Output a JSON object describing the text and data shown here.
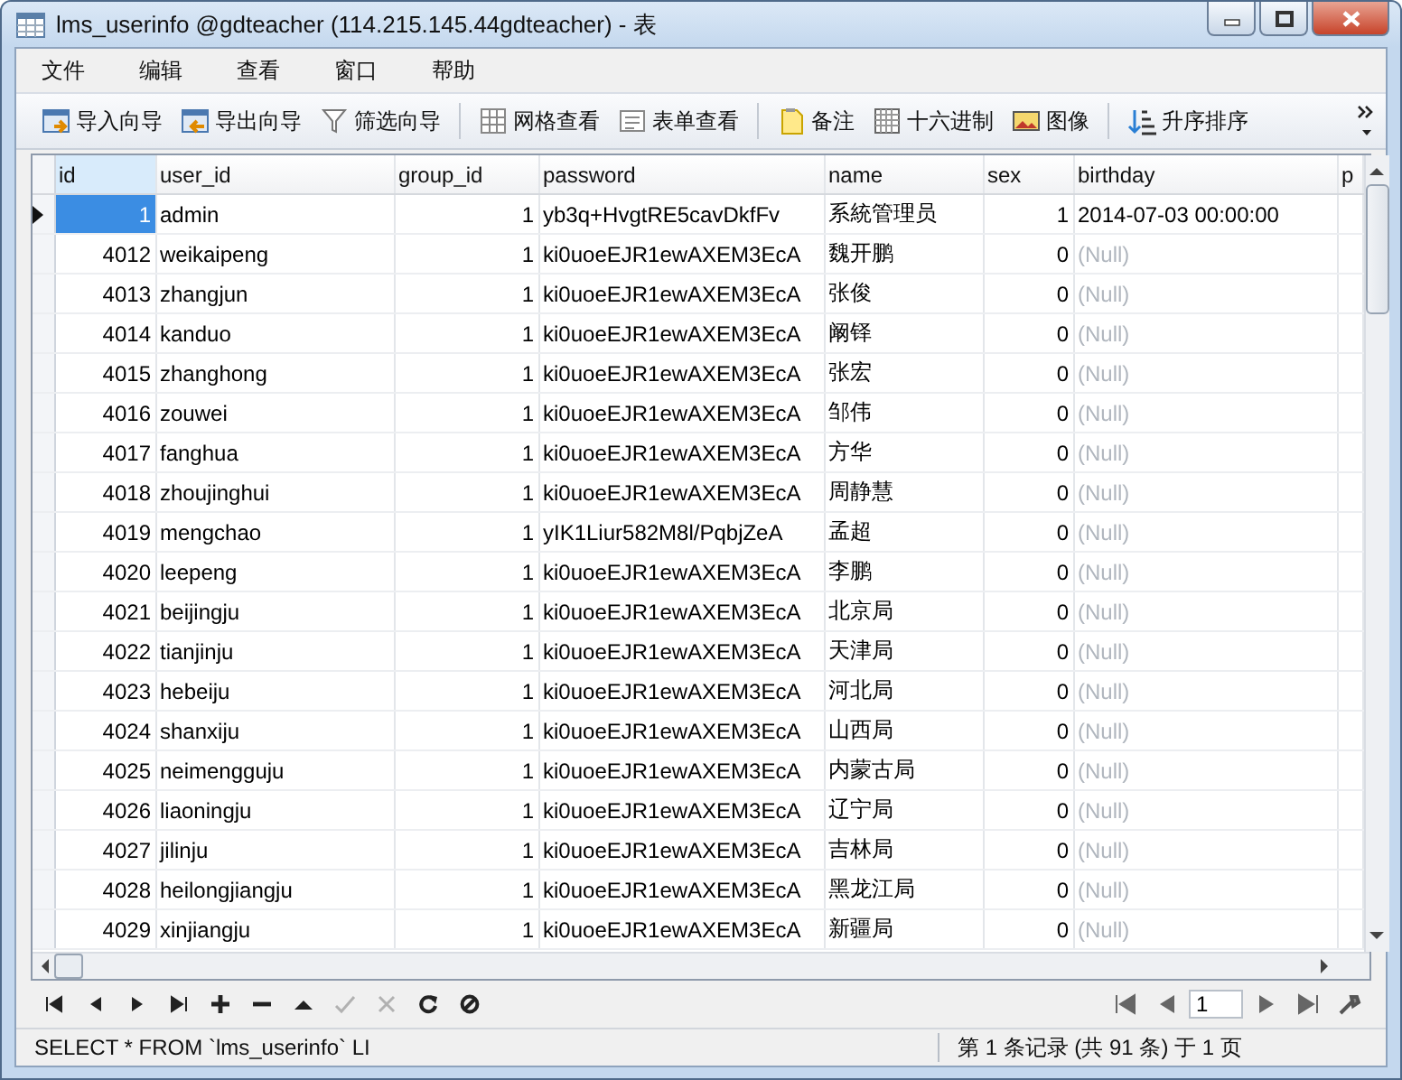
{
  "window": {
    "title": "lms_userinfo @gdteacher (114.215.145.44gdteacher) - 表"
  },
  "menu": [
    "文件",
    "编辑",
    "查看",
    "窗口",
    "帮助"
  ],
  "toolbar": [
    {
      "label": "导入向导",
      "kind": "import"
    },
    {
      "label": "导出向导",
      "kind": "export"
    },
    {
      "label": "筛选向导",
      "kind": "filter"
    },
    {
      "kind": "separator"
    },
    {
      "label": "网格查看",
      "kind": "grid"
    },
    {
      "label": "表单查看",
      "kind": "form"
    },
    {
      "kind": "separator"
    },
    {
      "label": "备注",
      "kind": "memo"
    },
    {
      "label": "十六进制",
      "kind": "hex"
    },
    {
      "label": "图像",
      "kind": "image"
    },
    {
      "kind": "separator"
    },
    {
      "label": "升序排序",
      "kind": "sort"
    }
  ],
  "table": {
    "columns": [
      "id",
      "user_id",
      "group_id",
      "password",
      "name",
      "sex",
      "birthday",
      "p"
    ],
    "rows": [
      {
        "id": "1",
        "user_id": "admin",
        "group_id": "1",
        "password": "yb3q+HvgtRE5cavDkfFv",
        "name": "系統管理员",
        "sex": "1",
        "birthday": "2014-07-03 00:00:00",
        "birthday_null": false,
        "selected": true
      },
      {
        "id": "4012",
        "user_id": "weikaipeng",
        "group_id": "1",
        "password": "ki0uoeEJR1ewAXEM3EcA",
        "name": "魏开鹏",
        "sex": "0",
        "birthday": "(Null)",
        "birthday_null": true,
        "selected": false
      },
      {
        "id": "4013",
        "user_id": "zhangjun",
        "group_id": "1",
        "password": "ki0uoeEJR1ewAXEM3EcA",
        "name": "张俊",
        "sex": "0",
        "birthday": "(Null)",
        "birthday_null": true,
        "selected": false
      },
      {
        "id": "4014",
        "user_id": "kanduo",
        "group_id": "1",
        "password": "ki0uoeEJR1ewAXEM3EcA",
        "name": "阚铎",
        "sex": "0",
        "birthday": "(Null)",
        "birthday_null": true,
        "selected": false
      },
      {
        "id": "4015",
        "user_id": "zhanghong",
        "group_id": "1",
        "password": "ki0uoeEJR1ewAXEM3EcA",
        "name": "张宏",
        "sex": "0",
        "birthday": "(Null)",
        "birthday_null": true,
        "selected": false
      },
      {
        "id": "4016",
        "user_id": "zouwei",
        "group_id": "1",
        "password": "ki0uoeEJR1ewAXEM3EcA",
        "name": "邹伟",
        "sex": "0",
        "birthday": "(Null)",
        "birthday_null": true,
        "selected": false
      },
      {
        "id": "4017",
        "user_id": "fanghua",
        "group_id": "1",
        "password": "ki0uoeEJR1ewAXEM3EcA",
        "name": "方华",
        "sex": "0",
        "birthday": "(Null)",
        "birthday_null": true,
        "selected": false
      },
      {
        "id": "4018",
        "user_id": "zhoujinghui",
        "group_id": "1",
        "password": "ki0uoeEJR1ewAXEM3EcA",
        "name": "周静慧",
        "sex": "0",
        "birthday": "(Null)",
        "birthday_null": true,
        "selected": false
      },
      {
        "id": "4019",
        "user_id": "mengchao",
        "group_id": "1",
        "password": "yIK1Liur582M8l/PqbjZeA",
        "name": "孟超",
        "sex": "0",
        "birthday": "(Null)",
        "birthday_null": true,
        "selected": false
      },
      {
        "id": "4020",
        "user_id": "leepeng",
        "group_id": "1",
        "password": "ki0uoeEJR1ewAXEM3EcA",
        "name": "李鹏",
        "sex": "0",
        "birthday": "(Null)",
        "birthday_null": true,
        "selected": false
      },
      {
        "id": "4021",
        "user_id": "beijingju",
        "group_id": "1",
        "password": "ki0uoeEJR1ewAXEM3EcA",
        "name": "北京局",
        "sex": "0",
        "birthday": "(Null)",
        "birthday_null": true,
        "selected": false
      },
      {
        "id": "4022",
        "user_id": "tianjinju",
        "group_id": "1",
        "password": "ki0uoeEJR1ewAXEM3EcA",
        "name": "天津局",
        "sex": "0",
        "birthday": "(Null)",
        "birthday_null": true,
        "selected": false
      },
      {
        "id": "4023",
        "user_id": "hebeiju",
        "group_id": "1",
        "password": "ki0uoeEJR1ewAXEM3EcA",
        "name": "河北局",
        "sex": "0",
        "birthday": "(Null)",
        "birthday_null": true,
        "selected": false
      },
      {
        "id": "4024",
        "user_id": "shanxiju",
        "group_id": "1",
        "password": "ki0uoeEJR1ewAXEM3EcA",
        "name": "山西局",
        "sex": "0",
        "birthday": "(Null)",
        "birthday_null": true,
        "selected": false
      },
      {
        "id": "4025",
        "user_id": "neimengguju",
        "group_id": "1",
        "password": "ki0uoeEJR1ewAXEM3EcA",
        "name": "内蒙古局",
        "sex": "0",
        "birthday": "(Null)",
        "birthday_null": true,
        "selected": false
      },
      {
        "id": "4026",
        "user_id": "liaoningju",
        "group_id": "1",
        "password": "ki0uoeEJR1ewAXEM3EcA",
        "name": "辽宁局",
        "sex": "0",
        "birthday": "(Null)",
        "birthday_null": true,
        "selected": false
      },
      {
        "id": "4027",
        "user_id": "jilinju",
        "group_id": "1",
        "password": "ki0uoeEJR1ewAXEM3EcA",
        "name": "吉林局",
        "sex": "0",
        "birthday": "(Null)",
        "birthday_null": true,
        "selected": false
      },
      {
        "id": "4028",
        "user_id": "heilongjiangju",
        "group_id": "1",
        "password": "ki0uoeEJR1ewAXEM3EcA",
        "name": "黑龙江局",
        "sex": "0",
        "birthday": "(Null)",
        "birthday_null": true,
        "selected": false
      },
      {
        "id": "4029",
        "user_id": "xinjiangju",
        "group_id": "1",
        "password": "ki0uoeEJR1ewAXEM3EcA",
        "name": "新疆局",
        "sex": "0",
        "birthday": "(Null)",
        "birthday_null": true,
        "selected": false
      }
    ]
  },
  "navigator": {
    "buttons": [
      {
        "kind": "first",
        "disabled": false
      },
      {
        "kind": "prev",
        "disabled": false
      },
      {
        "kind": "next",
        "disabled": false
      },
      {
        "kind": "last",
        "disabled": false
      },
      {
        "kind": "add",
        "disabled": false
      },
      {
        "kind": "delete",
        "disabled": false
      },
      {
        "kind": "up",
        "disabled": false
      },
      {
        "kind": "apply",
        "disabled": true
      },
      {
        "kind": "cancel",
        "disabled": true
      },
      {
        "kind": "refresh",
        "disabled": false
      },
      {
        "kind": "stop",
        "disabled": false
      }
    ],
    "page": "1"
  },
  "status_bar": {
    "sql": "SELECT * FROM `lms_userinfo` LI",
    "record_info": "第 1 条记录 (共 91 条) 于 1 页"
  }
}
